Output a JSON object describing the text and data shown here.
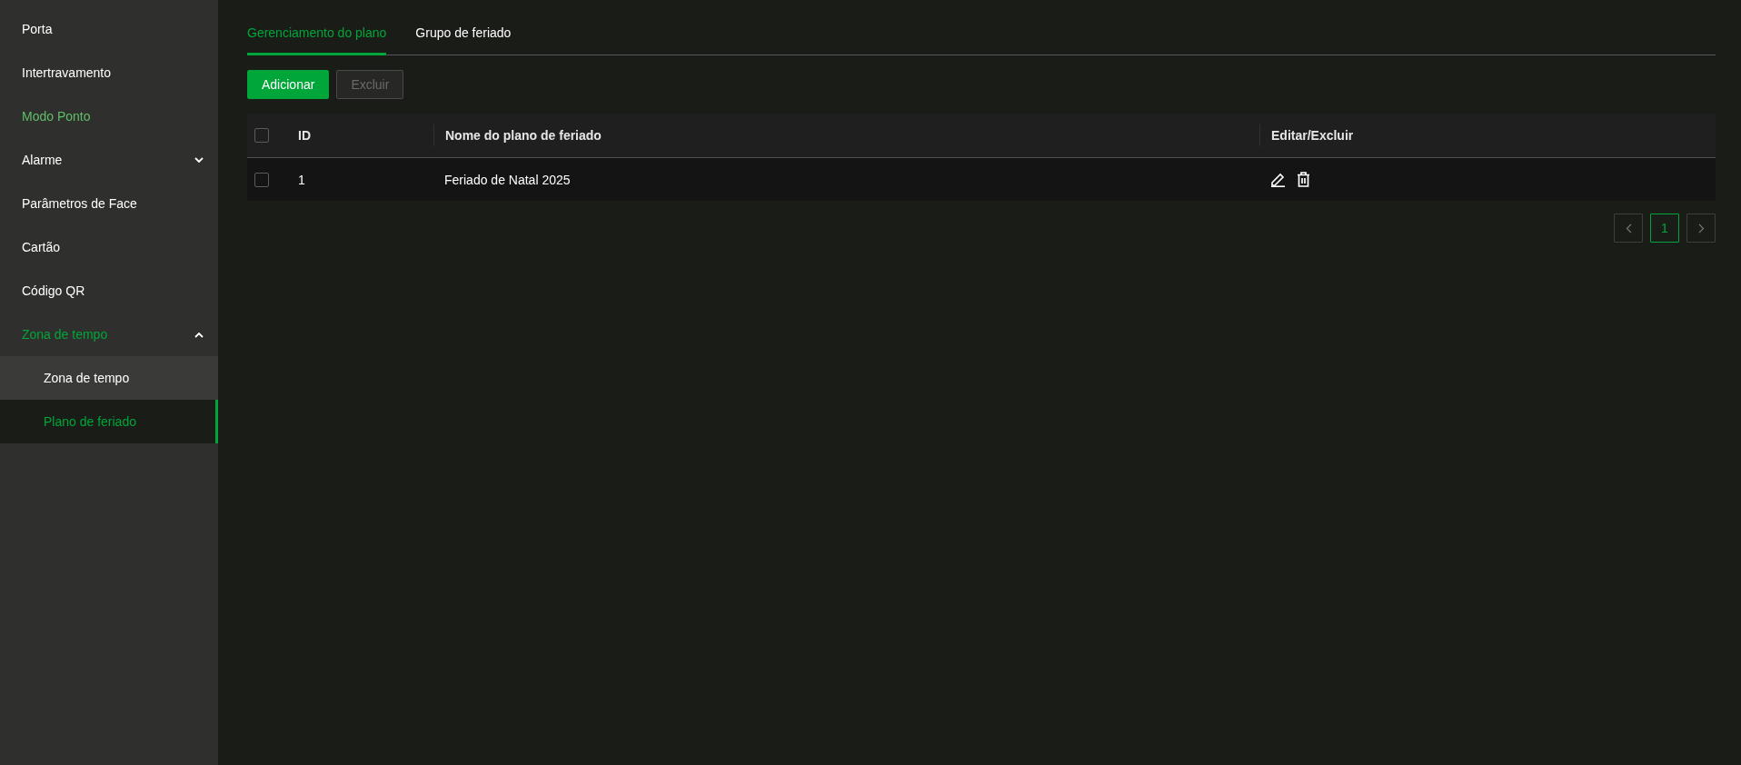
{
  "sidebar": {
    "items": [
      {
        "label": "Porta",
        "selected": false,
        "hovered": false
      },
      {
        "label": "Intertravamento",
        "selected": false,
        "hovered": false
      },
      {
        "label": "Modo Ponto",
        "selected": false,
        "hovered": true
      },
      {
        "label": "Alarme",
        "selected": false,
        "hovered": false,
        "expanded": false
      },
      {
        "label": "Parâmetros de Face",
        "selected": false,
        "hovered": false
      },
      {
        "label": "Cartão",
        "selected": false,
        "hovered": false
      },
      {
        "label": "Código QR",
        "selected": false,
        "hovered": false
      },
      {
        "label": "Zona de tempo",
        "selected": true,
        "hovered": false,
        "expanded": true,
        "children": [
          {
            "label": "Zona de tempo",
            "selected": false
          },
          {
            "label": "Plano de feriado",
            "selected": true
          }
        ]
      }
    ]
  },
  "tabs": [
    {
      "label": "Gerenciamento do plano",
      "selected": true
    },
    {
      "label": "Grupo de feriado",
      "selected": false
    }
  ],
  "buttons": [
    {
      "label": "Adicionar",
      "disabled": false
    },
    {
      "label": "Excluir",
      "disabled": true
    }
  ],
  "table": {
    "columns": [
      "ID",
      "Nome do plano de feriado",
      "Editar/Excluir"
    ],
    "all_checked": false,
    "rows": [
      {
        "checked": false,
        "id": "1",
        "name": "Feriado de Natal 2025"
      }
    ]
  },
  "pagination": {
    "pages": [
      {
        "label": "1",
        "selected": true
      }
    ]
  }
}
